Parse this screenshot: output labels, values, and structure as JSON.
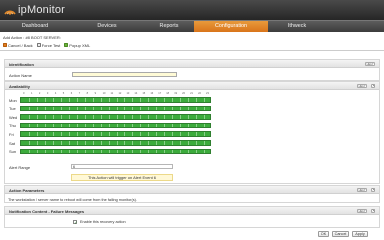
{
  "app": {
    "title": "ipMonitor"
  },
  "nav": {
    "items": [
      "Dashboard",
      "Devices",
      "Reports",
      "Configuration",
      "Ithweck"
    ],
    "active_index": 3
  },
  "breadcrumb": "Add Action : #8 BOOT SERVER:",
  "toolbar": {
    "items": [
      "Cancel / Back",
      "Force Test",
      "Popup XML"
    ]
  },
  "sections": {
    "identification": {
      "title": "Identification",
      "help": "HELP",
      "action_name_label": "Action Name",
      "action_name_value": ""
    },
    "availability": {
      "title": "Availability",
      "help": "HELP",
      "hours": [
        "0",
        "1",
        "2",
        "3",
        "4",
        "5",
        "6",
        "7",
        "8",
        "9",
        "10",
        "11",
        "12",
        "13",
        "14",
        "15",
        "16",
        "17",
        "18",
        "19",
        "20",
        "21",
        "22",
        "23"
      ],
      "days": [
        "Mon",
        "Tue",
        "Wed",
        "Thu",
        "Fri",
        "Sat",
        "Sun"
      ],
      "alert_range_label": "Alert Range",
      "alert_range_value": "6",
      "alert_note": "This Action will trigger on Alert Event 6"
    },
    "action_parameters": {
      "title": "Action Parameters",
      "help": "HELP",
      "description": "The workstation / server name to reboot will come from the failing monitor(s)."
    },
    "notification": {
      "title": "Notification Content - Failure Messages",
      "help": "HELP",
      "recovery_label": "Enable this recovery action",
      "recovery_checked": true
    }
  },
  "footer": {
    "ok": "OK",
    "cancel": "Cancel",
    "apply": "Apply"
  },
  "colors": {
    "accent": "#d9741a",
    "availability_bar": "#3cab3c",
    "header": "#2e2e2e"
  }
}
